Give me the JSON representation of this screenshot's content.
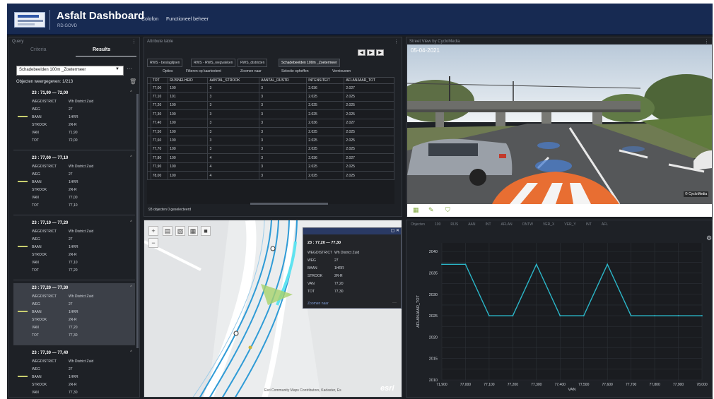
{
  "header": {
    "title": "Asfalt Dashboard",
    "subtitle": "RD.GOVD",
    "menu": [
      "Colofon",
      "Functioneel beheer"
    ]
  },
  "query": {
    "tabs": [
      "Criteria",
      "Results"
    ],
    "selection": "Schadebeelden 100m _Zoetermeer",
    "count_text": "Objecten weergegeven: 1/213",
    "cards": [
      {
        "title": "23 : 71,90 — 72,00",
        "selected": false,
        "rows": [
          [
            "WEGDISTRICT",
            "Wh District Zuid"
          ],
          [
            "WEG",
            "27"
          ],
          [
            "BAAN",
            "1HRR"
          ],
          [
            "STROOK",
            "2R-R"
          ],
          [
            "VAN",
            "71,90"
          ],
          [
            "TOT",
            "72,00"
          ]
        ]
      },
      {
        "title": "23 : 77,00 — 77,10",
        "selected": false,
        "rows": [
          [
            "WEGDISTRICT",
            "Wh District Zuid"
          ],
          [
            "WEG",
            "27"
          ],
          [
            "BAAN",
            "1HRR"
          ],
          [
            "STROOK",
            "2R-R"
          ],
          [
            "VAN",
            "77,00"
          ],
          [
            "TOT",
            "77,10"
          ]
        ]
      },
      {
        "title": "23 : 77,10 — 77,20",
        "selected": false,
        "rows": [
          [
            "WEGDISTRICT",
            "Wh District Zuid"
          ],
          [
            "WEG",
            "27"
          ],
          [
            "BAAN",
            "1HRR"
          ],
          [
            "STROOK",
            "2R-R"
          ],
          [
            "VAN",
            "77,10"
          ],
          [
            "TOT",
            "77,20"
          ]
        ]
      },
      {
        "title": "23 : 77,20 — 77,30",
        "selected": true,
        "rows": [
          [
            "WEGDISTRICT",
            "Wh District Zuid"
          ],
          [
            "WEG",
            "27"
          ],
          [
            "BAAN",
            "1HRR"
          ],
          [
            "STROOK",
            "2R-R"
          ],
          [
            "VAN",
            "77,20"
          ],
          [
            "TOT",
            "77,30"
          ]
        ]
      },
      {
        "title": "23 : 77,30 — 77,40",
        "selected": false,
        "rows": [
          [
            "WEGDISTRICT",
            "Wh District Zuid"
          ],
          [
            "WEG",
            "27"
          ],
          [
            "BAAN",
            "1HRR"
          ],
          [
            "STROOK",
            "2R-R"
          ],
          [
            "VAN",
            "77,30"
          ],
          [
            "TOT",
            "77,40"
          ]
        ]
      }
    ]
  },
  "attr_table": {
    "title": "Attribute table",
    "tabs": [
      "RWS - beslaglijnen",
      "RWS - RWS_wegvakken",
      "RWS_districten",
      "Schadebeelden 100m _Zoetermeer"
    ],
    "menu": [
      "Opties",
      "Filteren op kaartextent",
      "Zoomen naar",
      "Selectie opheffen",
      "Vernieuwen"
    ],
    "columns": [
      "TOT",
      "RIJSNELHEID",
      "AANTAL_STROOK",
      "AANTAL_RIJSTR",
      "INTENSITEIT",
      "AFLANJAAR_TOT"
    ],
    "rows": [
      [
        "77,00",
        "100",
        "3",
        "3",
        "2.036",
        "2.027"
      ],
      [
        "77,10",
        "101",
        "3",
        "3",
        "2.025",
        "2.025"
      ],
      [
        "77,20",
        "100",
        "3",
        "3",
        "2.025",
        "2.025"
      ],
      [
        "77,30",
        "100",
        "3",
        "3",
        "2.025",
        "2.025"
      ],
      [
        "77,40",
        "100",
        "3",
        "3",
        "2.036",
        "2.027"
      ],
      [
        "77,50",
        "100",
        "3",
        "3",
        "2.025",
        "2.025"
      ],
      [
        "77,60",
        "100",
        "3",
        "3",
        "2.025",
        "2.025"
      ],
      [
        "77,70",
        "100",
        "3",
        "3",
        "2.025",
        "2.025"
      ],
      [
        "77,80",
        "100",
        "4",
        "3",
        "2.036",
        "2.027"
      ],
      [
        "77,90",
        "100",
        "4",
        "3",
        "2.025",
        "2.025"
      ],
      [
        "78,00",
        "100",
        "4",
        "3",
        "2.025",
        "2.025"
      ]
    ],
    "status": "93 objecten 0 geselecteerd"
  },
  "street_view": {
    "title": "Street View by CycloMedia",
    "date": "05-04-2021",
    "badge": "© CycloMedia"
  },
  "map": {
    "popup": {
      "title": "23 : 77,20 — 77,30",
      "rows": [
        [
          "WEGDISTRICT",
          "Wh District Zuid"
        ],
        [
          "WEG",
          "27"
        ],
        [
          "BAAN",
          "1HRR"
        ],
        [
          "STROOK",
          "2R-R"
        ],
        [
          "VAN",
          "77,20"
        ],
        [
          "TOT",
          "77,30"
        ]
      ],
      "zoom_label": "Zoomen naar"
    },
    "credits": "Esri Community Maps Contributors, Kadaster, Es",
    "esri": "esri"
  },
  "chart_data": {
    "type": "line",
    "tabs": [
      "Objecten",
      "100",
      "RIJS",
      "AAN",
      "INT",
      "AFLAN",
      "ONTW",
      "VER_X",
      "VER_Y",
      "INT",
      "AFL"
    ],
    "x": [
      "71,900",
      "77,000",
      "77,100",
      "77,200",
      "77,300",
      "77,400",
      "77,500",
      "77,600",
      "77,700",
      "77,800",
      "77,900",
      "78,000"
    ],
    "xlabel": "VAN",
    "ylabel": "AFLANJAAR_TOT",
    "ylim": [
      2010,
      2042
    ],
    "yticks": [
      2010,
      2015,
      2020,
      2025,
      2030,
      2035,
      2040
    ],
    "values": [
      2037,
      2037,
      2025,
      2025,
      2037,
      2025,
      2025,
      2037,
      2025,
      2025,
      2025,
      2025
    ],
    "line_color": "#2bb6c8",
    "grid": true
  }
}
